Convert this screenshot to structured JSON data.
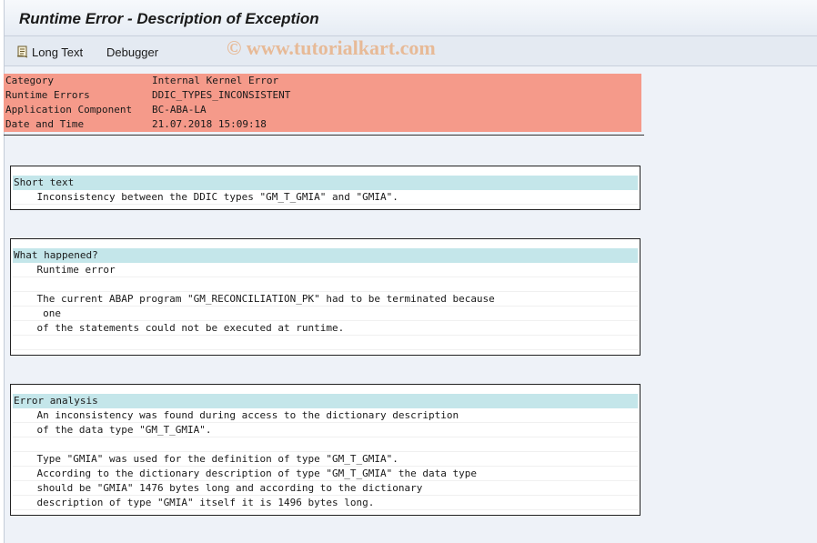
{
  "title": "Runtime Error - Description of Exception",
  "toolbar": {
    "long_text": "Long Text",
    "debugger": "Debugger"
  },
  "watermark": "© www.tutorialkart.com",
  "header_rows": [
    {
      "label": "Category",
      "value": "Internal Kernel Error"
    },
    {
      "label": "Runtime Errors",
      "value": "DDIC_TYPES_INCONSISTENT"
    },
    {
      "label": "Application Component",
      "value": "BC-ABA-LA"
    },
    {
      "label": "Date and Time",
      "value": "21.07.2018 15:09:18"
    }
  ],
  "short_text": {
    "heading": "Short text",
    "lines": [
      "    Inconsistency between the DDIC types \"GM_T_GMIA\" and \"GMIA\"."
    ]
  },
  "what_happened": {
    "heading": "What happened?",
    "lines": [
      "    Runtime error",
      "",
      "    The current ABAP program \"GM_RECONCILIATION_PK\" had to be terminated because",
      "     one",
      "    of the statements could not be executed at runtime.",
      ""
    ]
  },
  "error_analysis": {
    "heading": "Error analysis",
    "lines": [
      "    An inconsistency was found during access to the dictionary description",
      "    of the data type \"GM_T_GMIA\".",
      "",
      "    Type \"GMIA\" was used for the definition of type \"GM_T_GMIA\".",
      "    According to the dictionary description of type \"GM_T_GMIA\" the data type",
      "    should be \"GMIA\" 1476 bytes long and according to the dictionary",
      "    description of type \"GMIA\" itself it is 1496 bytes long."
    ]
  },
  "colors": {
    "header_bg": "#f59a8a",
    "section_head_bg": "#c4e6ea",
    "window_bg": "#eef2f8"
  },
  "icons": {
    "long_text": "document-icon"
  }
}
